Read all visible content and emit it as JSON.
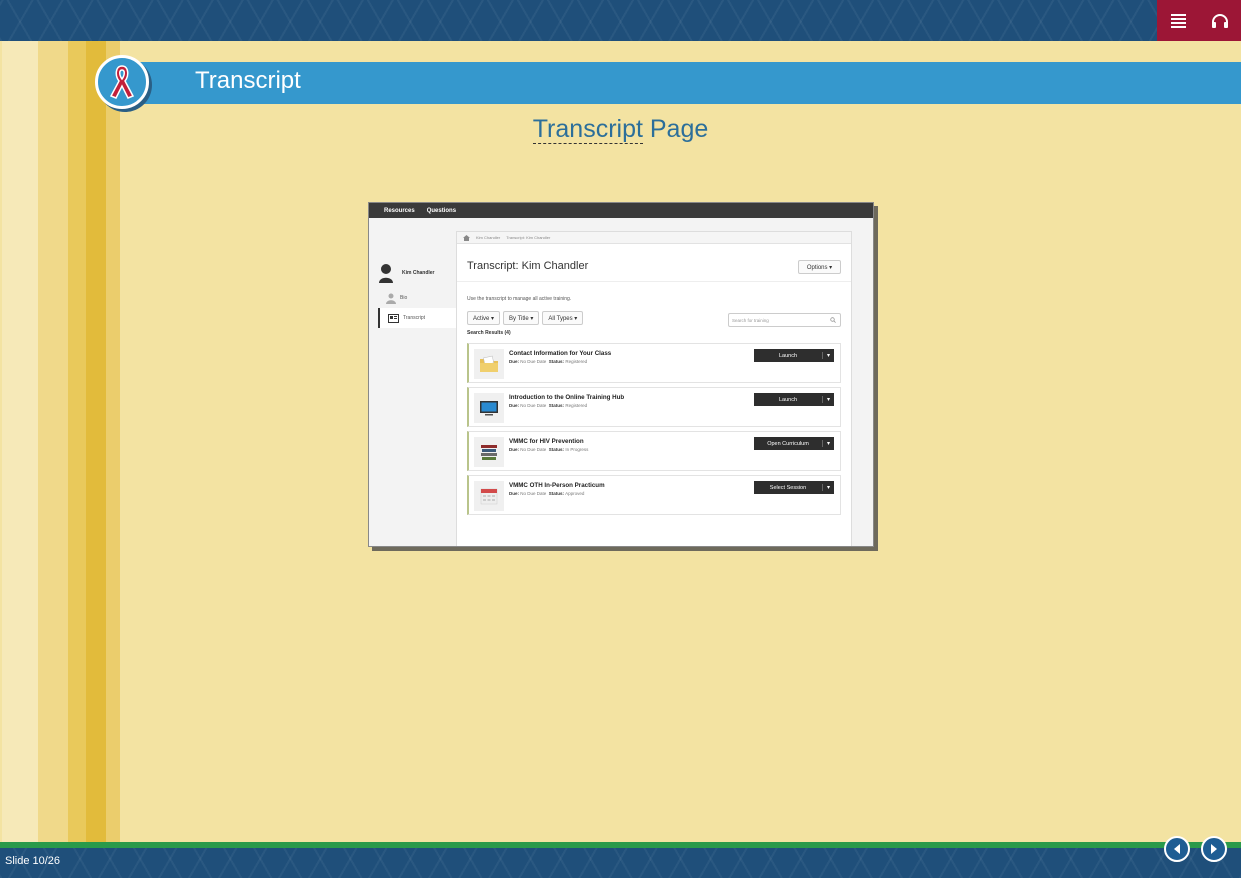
{
  "topbar": {
    "menu_icon": "menu-icon",
    "audio_icon": "headphones-icon"
  },
  "header": {
    "title": "Transcript",
    "badge_icon": "awareness-ribbon-icon"
  },
  "slide": {
    "heading_part1": "Transcript",
    "heading_part2": " Page"
  },
  "screenshot": {
    "nav": [
      "Resources",
      "Questions"
    ],
    "breadcrumb": [
      "Kim Chandler",
      "Transcript: Kim Chandler"
    ],
    "user_name": "Kim Chandler",
    "sidebar": [
      "Bio",
      "Transcript"
    ],
    "title": "Transcript: Kim Chandler",
    "options_label": "Options ▾",
    "intro": "Use the transcript to manage all active training.",
    "filters": [
      "Active ▾",
      "By Title ▾",
      "All Types ▾"
    ],
    "search_placeholder": "Search for training",
    "results_label": "Search Results (4)",
    "due_label": "Due:",
    "status_label": "Status:",
    "items": [
      {
        "title": "Contact Information for Your Class",
        "due": "No Due Date",
        "status": "Registered",
        "action": "Launch",
        "icon": "folder-icon"
      },
      {
        "title": "Introduction to the Online Training Hub",
        "due": "No Due Date",
        "status": "Registered",
        "action": "Launch",
        "icon": "monitor-icon"
      },
      {
        "title": "VMMC for HIV Prevention",
        "due": "No Due Date",
        "status": "In Progress",
        "action": "Open Curriculum",
        "icon": "books-icon"
      },
      {
        "title": "VMMC OTH In-Person Practicum",
        "due": "No Due Date",
        "status": "Approved",
        "action": "Select Session",
        "icon": "calendar-icon"
      }
    ]
  },
  "footer": {
    "slide_counter": "Slide 10/26",
    "prev_icon": "prev-arrow-icon",
    "next_icon": "next-arrow-icon"
  },
  "colors": {
    "accent_blue": "#3598cd",
    "topbar": "#1f4f7a",
    "menu_red": "#9c1636",
    "green": "#2a9a4a",
    "background": "#f3e3a2"
  }
}
